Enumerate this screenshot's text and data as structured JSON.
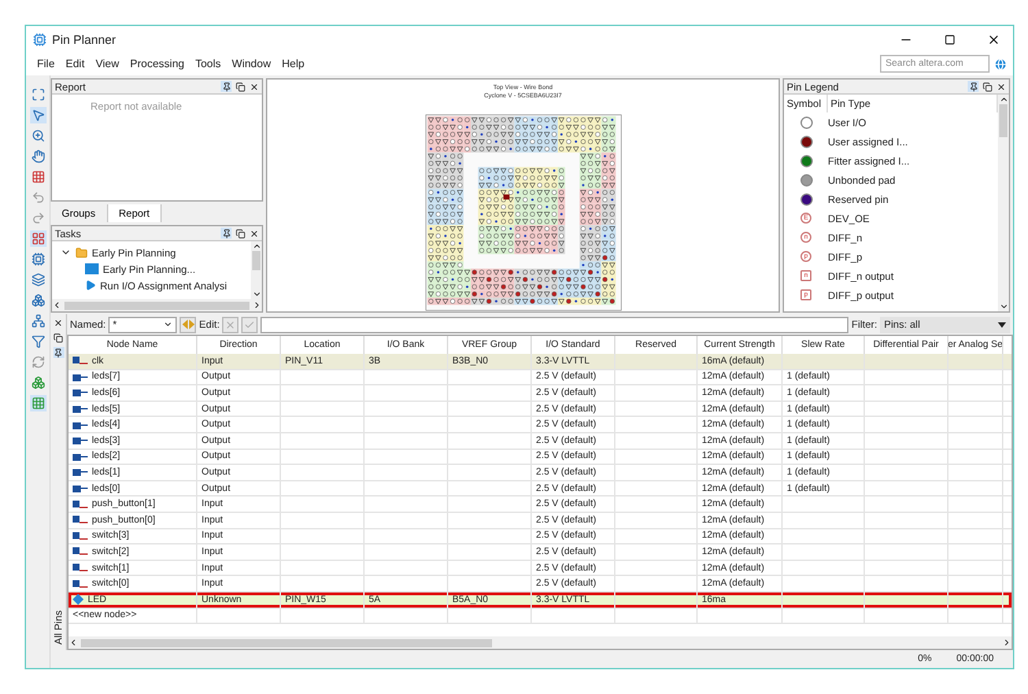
{
  "window": {
    "title": "Pin Planner"
  },
  "menu": [
    {
      "label": "File"
    },
    {
      "label": "Edit"
    },
    {
      "label": "View"
    },
    {
      "label": "Processing"
    },
    {
      "label": "Tools"
    },
    {
      "label": "Window"
    },
    {
      "label": "Help"
    }
  ],
  "search": {
    "placeholder": "Search altera.com"
  },
  "report": {
    "title": "Report",
    "message": "Report not available",
    "tabs": [
      {
        "label": "Groups",
        "selected": false
      },
      {
        "label": "Report",
        "selected": true
      }
    ]
  },
  "tasks": {
    "title": "Tasks",
    "items": [
      {
        "label": "Early Pin Planning",
        "kind": "folder",
        "expanded": true,
        "children": [
          {
            "label": "Early Pin Planning...",
            "kind": "window"
          },
          {
            "label": "Run I/O Assignment Analysi",
            "kind": "run"
          }
        ]
      }
    ]
  },
  "chip": {
    "title": "Top View - Wire Bond",
    "subtitle": "Cyclone V - 5CSEBA6U23I7"
  },
  "legend": {
    "title": "Pin Legend",
    "columns": [
      "Symbol",
      "Pin Type"
    ],
    "items": [
      {
        "kind": "dot",
        "color": "#ffffff",
        "label": "User I/O"
      },
      {
        "kind": "dot",
        "color": "#7a0a0a",
        "label": "User assigned I..."
      },
      {
        "kind": "dot",
        "color": "#0f7a1a",
        "label": "Fitter assigned I..."
      },
      {
        "kind": "dot",
        "color": "#9a9a9a",
        "label": "Unbonded pad"
      },
      {
        "kind": "dot",
        "color": "#3a0a80",
        "label": "Reserved pin"
      },
      {
        "kind": "circle",
        "letter": "E",
        "label": "DEV_OE"
      },
      {
        "kind": "circle",
        "letter": "n",
        "label": "DIFF_n"
      },
      {
        "kind": "circle",
        "letter": "p",
        "label": "DIFF_p"
      },
      {
        "kind": "square",
        "letter": "n",
        "label": "DIFF_n output"
      },
      {
        "kind": "square",
        "letter": "p",
        "label": "DIFF_p output"
      }
    ]
  },
  "filter_bar": {
    "named_label": "Named:",
    "named_value": "*",
    "edit_label": "Edit:",
    "filter_label": "Filter:",
    "filter_value": "Pins: all"
  },
  "side_tab": "All Pins",
  "table": {
    "columns": [
      "Node Name",
      "Direction",
      "Location",
      "I/O Bank",
      "VREF Group",
      "I/O Standard",
      "Reserved",
      "Current Strength",
      "Slew Rate",
      "Differential Pair",
      "er Analog Se"
    ],
    "rows": [
      {
        "kind": "input",
        "name": "clk",
        "direction": "Input",
        "location": "PIN_V11",
        "bank": "3B",
        "vref": "B3B_N0",
        "standard": "3.3-V LVTTL",
        "current": "16mA (default)",
        "selected": true,
        "marked": false
      },
      {
        "kind": "output",
        "name": "leds[7]",
        "direction": "Output",
        "standard": "2.5 V (default)",
        "current": "12mA (default)",
        "slew": "1 (default)",
        "selected": false,
        "marked": false
      },
      {
        "kind": "output",
        "name": "leds[6]",
        "direction": "Output",
        "standard": "2.5 V (default)",
        "current": "12mA (default)",
        "slew": "1 (default)",
        "selected": false,
        "marked": false
      },
      {
        "kind": "output",
        "name": "leds[5]",
        "direction": "Output",
        "standard": "2.5 V (default)",
        "current": "12mA (default)",
        "slew": "1 (default)",
        "selected": false,
        "marked": false
      },
      {
        "kind": "output",
        "name": "leds[4]",
        "direction": "Output",
        "standard": "2.5 V (default)",
        "current": "12mA (default)",
        "slew": "1 (default)",
        "selected": false,
        "marked": false
      },
      {
        "kind": "output",
        "name": "leds[3]",
        "direction": "Output",
        "standard": "2.5 V (default)",
        "current": "12mA (default)",
        "slew": "1 (default)",
        "selected": false,
        "marked": false
      },
      {
        "kind": "output",
        "name": "leds[2]",
        "direction": "Output",
        "standard": "2.5 V (default)",
        "current": "12mA (default)",
        "slew": "1 (default)",
        "selected": false,
        "marked": false
      },
      {
        "kind": "output",
        "name": "leds[1]",
        "direction": "Output",
        "standard": "2.5 V (default)",
        "current": "12mA (default)",
        "slew": "1 (default)",
        "selected": false,
        "marked": false
      },
      {
        "kind": "output",
        "name": "leds[0]",
        "direction": "Output",
        "standard": "2.5 V (default)",
        "current": "12mA (default)",
        "slew": "1 (default)",
        "selected": false,
        "marked": false
      },
      {
        "kind": "input",
        "name": "push_button[1]",
        "direction": "Input",
        "standard": "2.5 V (default)",
        "current": "12mA (default)",
        "selected": false,
        "marked": false
      },
      {
        "kind": "input",
        "name": "push_button[0]",
        "direction": "Input",
        "standard": "2.5 V (default)",
        "current": "12mA (default)",
        "selected": false,
        "marked": false
      },
      {
        "kind": "input",
        "name": "switch[3]",
        "direction": "Input",
        "standard": "2.5 V (default)",
        "current": "12mA (default)",
        "selected": false,
        "marked": false
      },
      {
        "kind": "input",
        "name": "switch[2]",
        "direction": "Input",
        "standard": "2.5 V (default)",
        "current": "12mA (default)",
        "selected": false,
        "marked": false
      },
      {
        "kind": "input",
        "name": "switch[1]",
        "direction": "Input",
        "standard": "2.5 V (default)",
        "current": "12mA (default)",
        "selected": false,
        "marked": false
      },
      {
        "kind": "input",
        "name": "switch[0]",
        "direction": "Input",
        "standard": "2.5 V (default)",
        "current": "12mA (default)",
        "selected": false,
        "marked": false
      },
      {
        "kind": "unknown",
        "name": "LED",
        "direction": "Unknown",
        "location": "PIN_W15",
        "bank": "5A",
        "vref": "B5A_N0",
        "standard": "3.3-V LVTTL",
        "current": "16ma",
        "selected": false,
        "marked": true
      },
      {
        "kind": "new",
        "name": "<<new node>>",
        "selected": false,
        "marked": false
      }
    ]
  },
  "status": {
    "progress": "0%",
    "time": "00:00:00"
  }
}
